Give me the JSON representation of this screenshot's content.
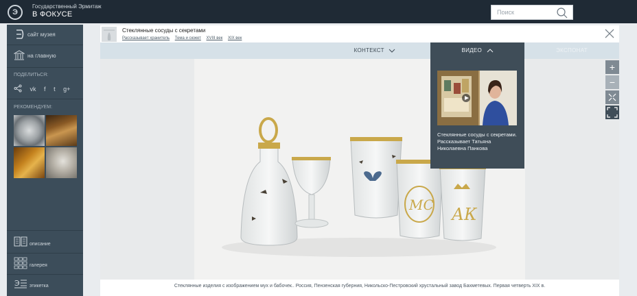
{
  "header": {
    "logo_glyph": "Э",
    "site_title": "Государственный Эрмитаж",
    "site_subtitle": "В ФОКУСЕ",
    "search_placeholder": "Поиск",
    "search_icon": "search-icon"
  },
  "sidebar": {
    "museum_site": "сайт музея",
    "home": "на главную",
    "share_heading": "ПОДЕЛИТЬСЯ:",
    "share_items": [
      "vk",
      "f",
      "t",
      "g+"
    ],
    "recommend_heading": "РЕКОМЕНДУЕМ:",
    "bottom_items": [
      {
        "label": "описание",
        "icon": "description-icon"
      },
      {
        "label": "галерея",
        "icon": "gallery-icon"
      },
      {
        "label": "этикетка",
        "icon": "label-icon"
      }
    ]
  },
  "panel": {
    "title": "Стеклянные сосуды с секретами",
    "links": [
      "Рассказывает хранитель",
      "Тема и сюжет",
      "XVIII век",
      "XIX век"
    ],
    "tabs": {
      "context": "КОНТЕКСТ",
      "video": "ВИДЕО",
      "exhibit": "ЭКСПОНАТ"
    },
    "video_caption": "Стеклянные сосуды с секретами. Рассказывает Татьяна Николаевна Панкова",
    "zoom_in": "+",
    "zoom_out": "−",
    "caption": "Стеклянные изделия с изображением мух и бабочек.. Россия, Пензенская губерния, Никольско-Пестровский хрустальный завод Бахметевых. Первая четверть XIX в."
  },
  "colors": {
    "topbar": "#1f2a35",
    "sidebar": "#3c4d5a",
    "tabbar": "#d6e1e8",
    "video_tab": "#3f4d58"
  }
}
